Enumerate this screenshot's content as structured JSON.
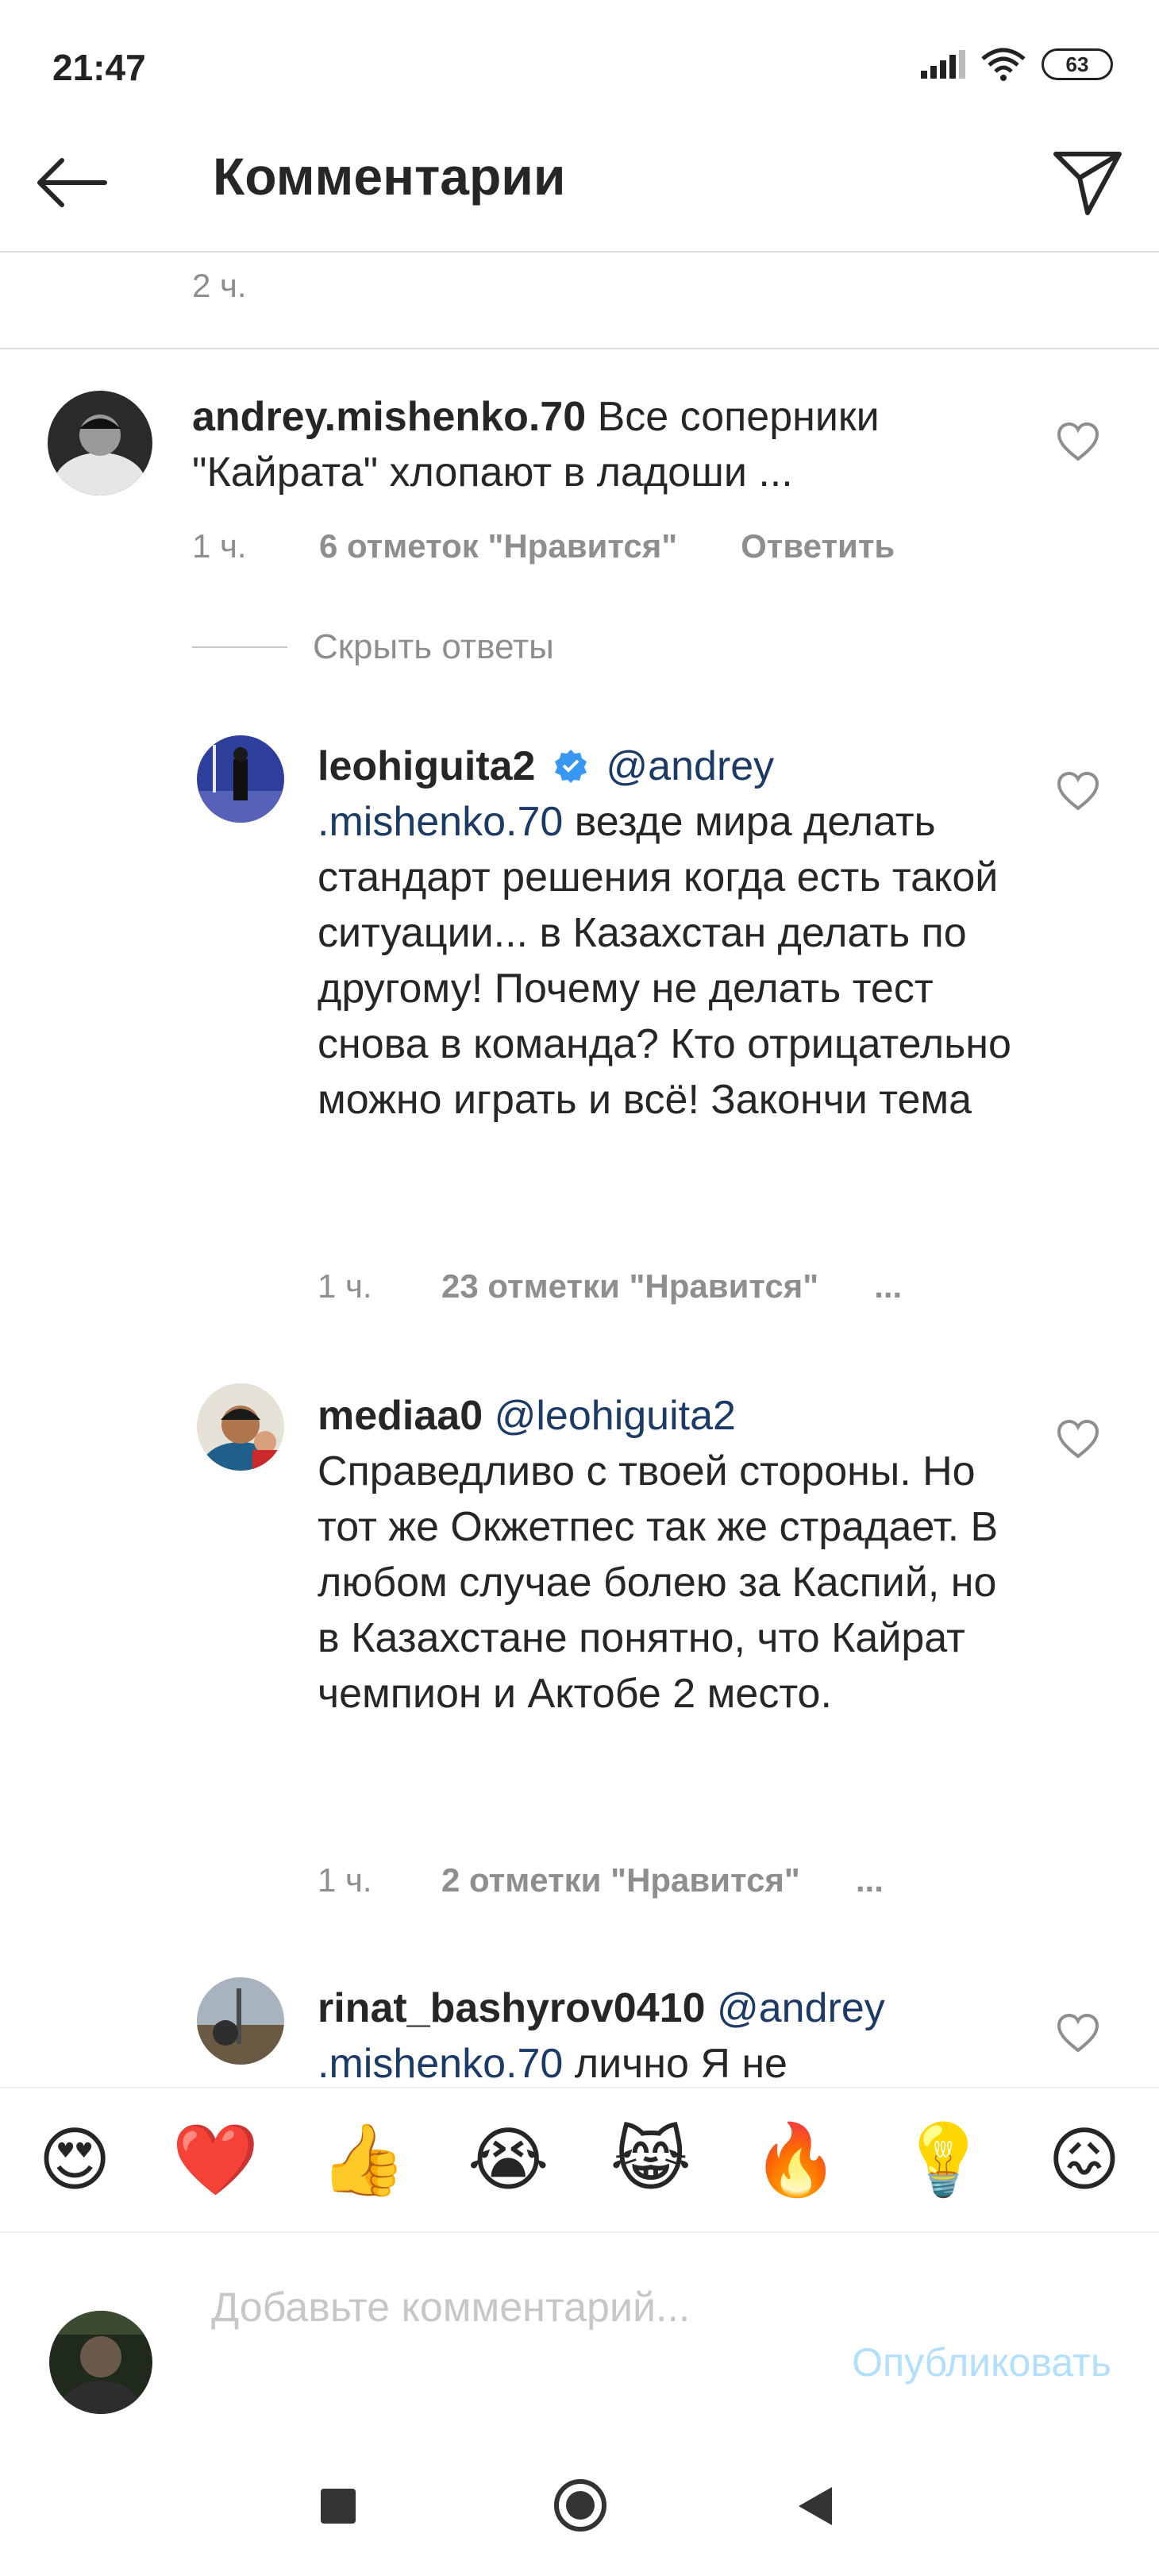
{
  "status": {
    "time": "21:47",
    "battery": "63"
  },
  "header": {
    "title": "Комментарии"
  },
  "caption": {
    "time": "2 ч."
  },
  "comments": [
    {
      "username": "andrey.mishenko.70",
      "text": "Все соперники \"Кайрата\" хлопают в ладоши ...",
      "time": "1 ч.",
      "likes": "6 отметок \"Нравится\"",
      "reply": "Ответить"
    }
  ],
  "hide_replies": "Скрыть ответы",
  "replies": [
    {
      "username": "leohiguita2",
      "mention": "@andrey .mishenko.70",
      "text": "везде мира делать стандарт решения когда есть такой ситуации... в Казахстан делать по другому! Почему не делать тест снова в команда? Кто отрицательно можно играть и всё! Закончи тема",
      "time": "1 ч.",
      "likes": "23 отметки \"Нравится\"",
      "more": "..."
    },
    {
      "username": "mediaa0",
      "mention": "@leohiguita2",
      "text": "Справедливо с твоей стороны. Но тот же Окжетпес так же страдает. В любом случае болею за Каспий, но в Казахстане понятно, что Кайрат чемпион и Актобе 2 место.",
      "time": "1 ч.",
      "likes": "2 отметки \"Нравится\"",
      "more": "..."
    },
    {
      "username": "rinat_bashyrov0410",
      "mention": "@andrey .mishenko.70",
      "text": "лично Я не"
    }
  ],
  "emojis": [
    "😍",
    "❤️",
    "👍",
    "😭",
    "😹",
    "🔥",
    "💡",
    "😖"
  ],
  "input": {
    "placeholder": "Добавьте комментарий...",
    "publish": "Опубликовать"
  },
  "colors": {
    "accent": "#0095f6",
    "publish_disabled": "#b2dffc",
    "verified": "#3897f0",
    "mention": "#1b3a67"
  }
}
